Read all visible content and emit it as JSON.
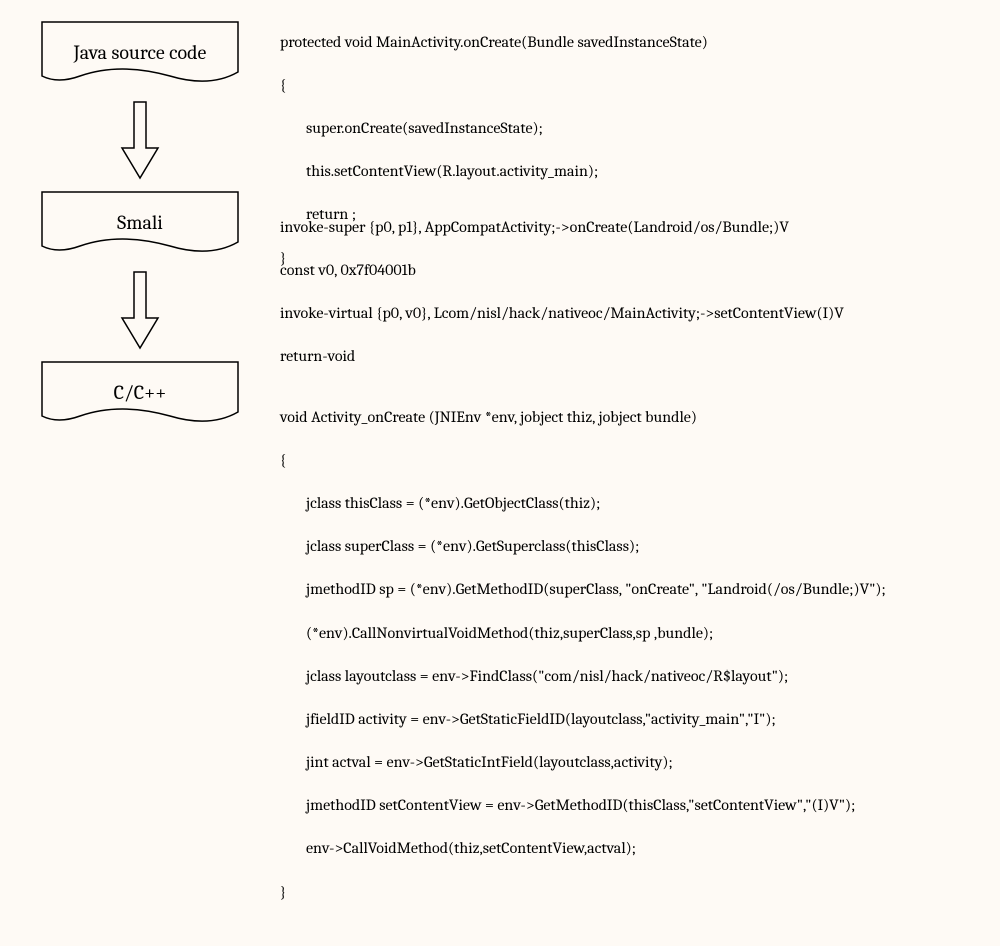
{
  "boxes": {
    "java": "Java source code",
    "smali": "Smali",
    "cpp": "C/C++"
  },
  "code": {
    "java": {
      "l1": "protected void MainActivity.onCreate(Bundle savedInstanceState)",
      "l2": "{",
      "l3": "super.onCreate(savedInstanceState);",
      "l4": "this.setContentView(R.layout.activity_main);",
      "l5": "return ;",
      "l6": "}"
    },
    "smali": {
      "l1": "invoke-super {p0, p1}, AppCompatActivity;->onCreate(Landroid/os/Bundle;)V",
      "l2": "const v0, 0x7f04001b",
      "l3": "invoke-virtual {p0, v0}, Lcom/nisl/hack/nativeoc/MainActivity;->setContentView(I)V",
      "l4": "return-void"
    },
    "cpp": {
      "l1": "void Activity_onCreate (JNIEnv *env, jobject thiz, jobject bundle)",
      "l2": "{",
      "l3": "jclass thisClass = (*env).GetObjectClass(thiz);",
      "l4": "jclass superClass = (*env).GetSuperclass(thisClass);",
      "l5": "jmethodID sp = (*env).GetMethodID(superClass, \"onCreate\", \"Landroid(/os/Bundle;)V\");",
      "l6": "(*env).CallNonvirtualVoidMethod(thiz,superClass,sp ,bundle);",
      "l7": "jclass layoutclass = env->FindClass(\"com/nisl/hack/nativeoc/R$layout\");",
      "l8": "jfieldID activity = env->GetStaticFieldID(layoutclass,\"activity_main\",\"I\");",
      "l9": "jint actval = env->GetStaticIntField(layoutclass,activity);",
      "l10": "jmethodID setContentView = env->GetMethodID(thisClass,\"setContentView\",\"(I)V\");",
      "l11": "env->CallVoidMethod(thiz,setContentView,actval);",
      "l12": "}"
    }
  }
}
